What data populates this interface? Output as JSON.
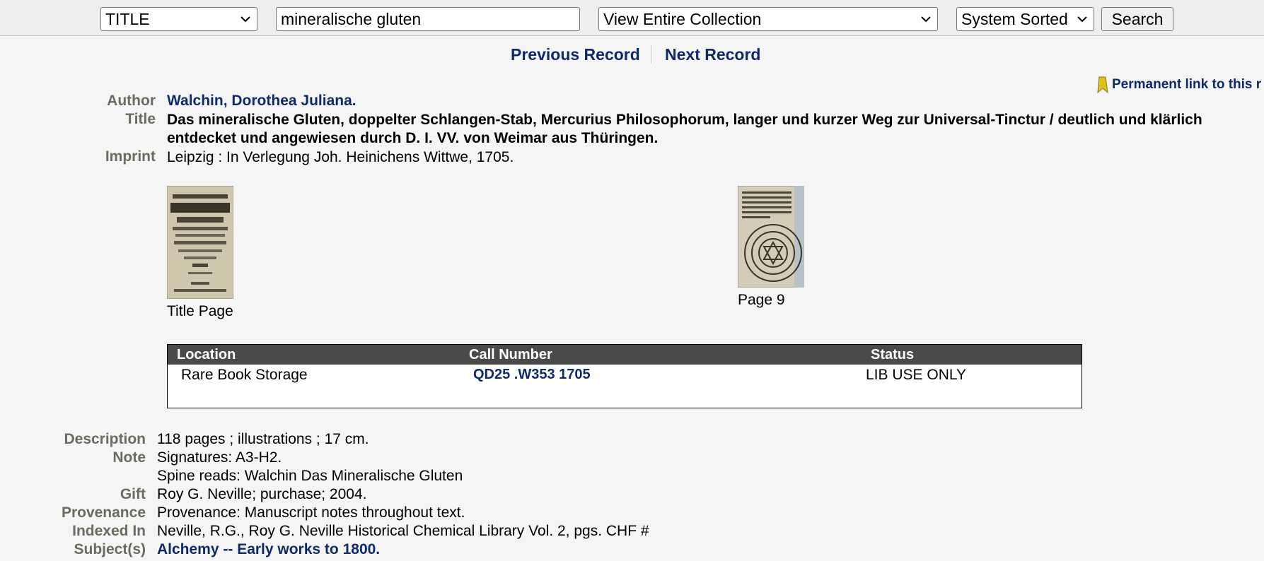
{
  "search": {
    "field_value": "TITLE",
    "query": "mineralische gluten",
    "collection": "View Entire Collection",
    "sort": "System Sorted",
    "button": "Search"
  },
  "nav": {
    "previous": "Previous Record",
    "next": "Next Record"
  },
  "permalink": "Permanent link to this r",
  "record": {
    "author_label": "Author",
    "author": "Walchin, Dorothea Juliana.",
    "title_label": "Title",
    "title_line1": "Das mineralische Gluten, doppelter Schlangen-Stab, Mercurius Philosophorum, langer und kurzer Weg zur Universal-Tinctur / deutlich und klärlich",
    "title_line2": "entdecket und angewiesen durch D. I. VV. von Weimar aus Thüringen.",
    "imprint_label": "Imprint",
    "imprint": "Leipzig : In Verlegung Joh. Heinichens Wittwe, 1705."
  },
  "images": [
    {
      "caption": "Title Page"
    },
    {
      "caption": "Page 9"
    }
  ],
  "holdings": {
    "headers": [
      "Location",
      "Call Number",
      "Status"
    ],
    "rows": [
      {
        "location": "Rare Book Storage",
        "call_number": "QD25 .W353 1705",
        "status": "LIB USE ONLY"
      }
    ]
  },
  "details": {
    "description_label": "Description",
    "description": "118 pages ; illustrations ; 17 cm.",
    "note_label": "Note",
    "note1": "Signatures: A3-H2.",
    "note2": "Spine reads: Walchin Das Mineralische Gluten",
    "gift_label": "Gift",
    "gift": "Roy G. Neville; purchase; 2004.",
    "provenance_label": "Provenance",
    "provenance": "Provenance: Manuscript notes throughout text.",
    "indexed_label": "Indexed In",
    "indexed": "Neville, R.G., Roy G. Neville Historical Chemical Library Vol. 2, pgs. CHF #",
    "subjects_label": "Subject(s)",
    "subject": "Alchemy -- Early works to 1800."
  },
  "colors": {
    "link": "#0f2a6b",
    "label": "#6b6b5f",
    "table_header": "#4a4a4a"
  }
}
